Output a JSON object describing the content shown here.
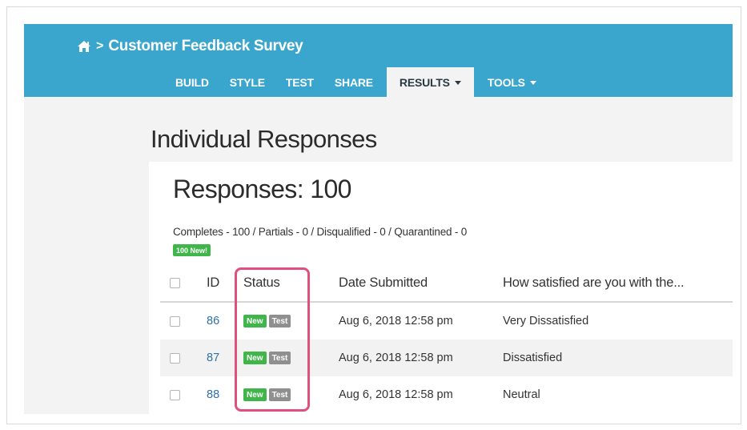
{
  "header": {
    "survey_title": "Customer Feedback Survey",
    "breadcrumb_separator": ">",
    "tabs": [
      {
        "label": "BUILD",
        "active": false,
        "dropdown": false
      },
      {
        "label": "STYLE",
        "active": false,
        "dropdown": false
      },
      {
        "label": "TEST",
        "active": false,
        "dropdown": false
      },
      {
        "label": "SHARE",
        "active": false,
        "dropdown": false
      },
      {
        "label": "RESULTS",
        "active": true,
        "dropdown": true
      },
      {
        "label": "TOOLS",
        "active": false,
        "dropdown": true
      }
    ]
  },
  "page": {
    "title": "Individual Responses"
  },
  "responses": {
    "count_label": "Responses: 100",
    "summary": "Completes - 100 / Partials - 0 / Disqualified - 0 / Quarantined - 0",
    "new_badge": "100 New!"
  },
  "table": {
    "headers": {
      "id": "ID",
      "status": "Status",
      "date": "Date Submitted",
      "question": "How satisfied are you with the..."
    },
    "rows": [
      {
        "id": "86",
        "tags": [
          "New",
          "Test"
        ],
        "date": "Aug 6, 2018 12:58 pm",
        "answer": "Very Dissatisfied"
      },
      {
        "id": "87",
        "tags": [
          "New",
          "Test"
        ],
        "date": "Aug 6, 2018 12:58 pm",
        "answer": "Dissatisfied"
      },
      {
        "id": "88",
        "tags": [
          "New",
          "Test"
        ],
        "date": "Aug 6, 2018 12:58 pm",
        "answer": "Neutral"
      }
    ]
  },
  "icons": {
    "home": "home-icon",
    "chevron": "chevron-right-icon",
    "caret": "caret-down-icon"
  },
  "colors": {
    "header_bg": "#3ba6cd",
    "new_tag": "#3fb54a",
    "test_tag": "#8f8f8f",
    "link": "#2f6fa8",
    "highlight": "#e0507c"
  }
}
